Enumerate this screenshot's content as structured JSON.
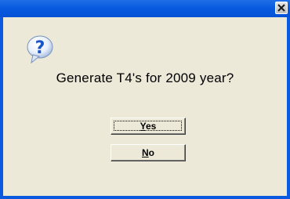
{
  "dialog": {
    "message": "Generate T4's for 2009 year?",
    "icon": "question-icon",
    "close_glyph": "✕"
  },
  "buttons": {
    "yes": {
      "mnemonic": "Y",
      "rest": "es"
    },
    "no": {
      "mnemonic": "N",
      "rest": "o"
    }
  },
  "colors": {
    "titlebar": "#0a5ae0",
    "dialog_bg": "#ece9d8",
    "icon_blue": "#1a55c8"
  }
}
